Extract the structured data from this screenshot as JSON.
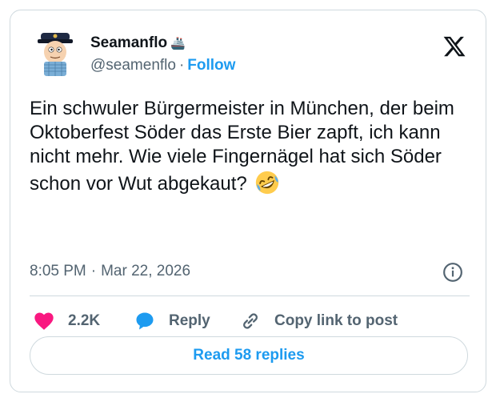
{
  "author": {
    "name": "Seamanflo",
    "badge": "🚢",
    "handle": "@seamenflo",
    "separator": "·",
    "follow_label": "Follow"
  },
  "tweet": {
    "text": "Ein schwuler Bürgermeister in München, der beim Oktoberfest Söder das Erste Bier zapft, ich kann nicht mehr. Wie viele Fingernägel hat sich Söder schon vor Wut abgekaut?",
    "emoji": "rolling-on-floor-laughing-emoji",
    "time": "8:05 PM",
    "separator": "·",
    "date": "Mar 22, 2026"
  },
  "actions": {
    "like_count": "2.2K",
    "reply_label": "Reply",
    "copy_label": "Copy link to post"
  },
  "read_replies_label": "Read 58 replies",
  "colors": {
    "accent": "#1d9bf0",
    "like": "#f91880",
    "muted": "#536471",
    "text": "#0f1419",
    "border": "#cfd9de"
  },
  "icons": [
    "x-logo-icon",
    "info-icon",
    "heart-icon",
    "reply-bubble-icon",
    "link-icon"
  ]
}
